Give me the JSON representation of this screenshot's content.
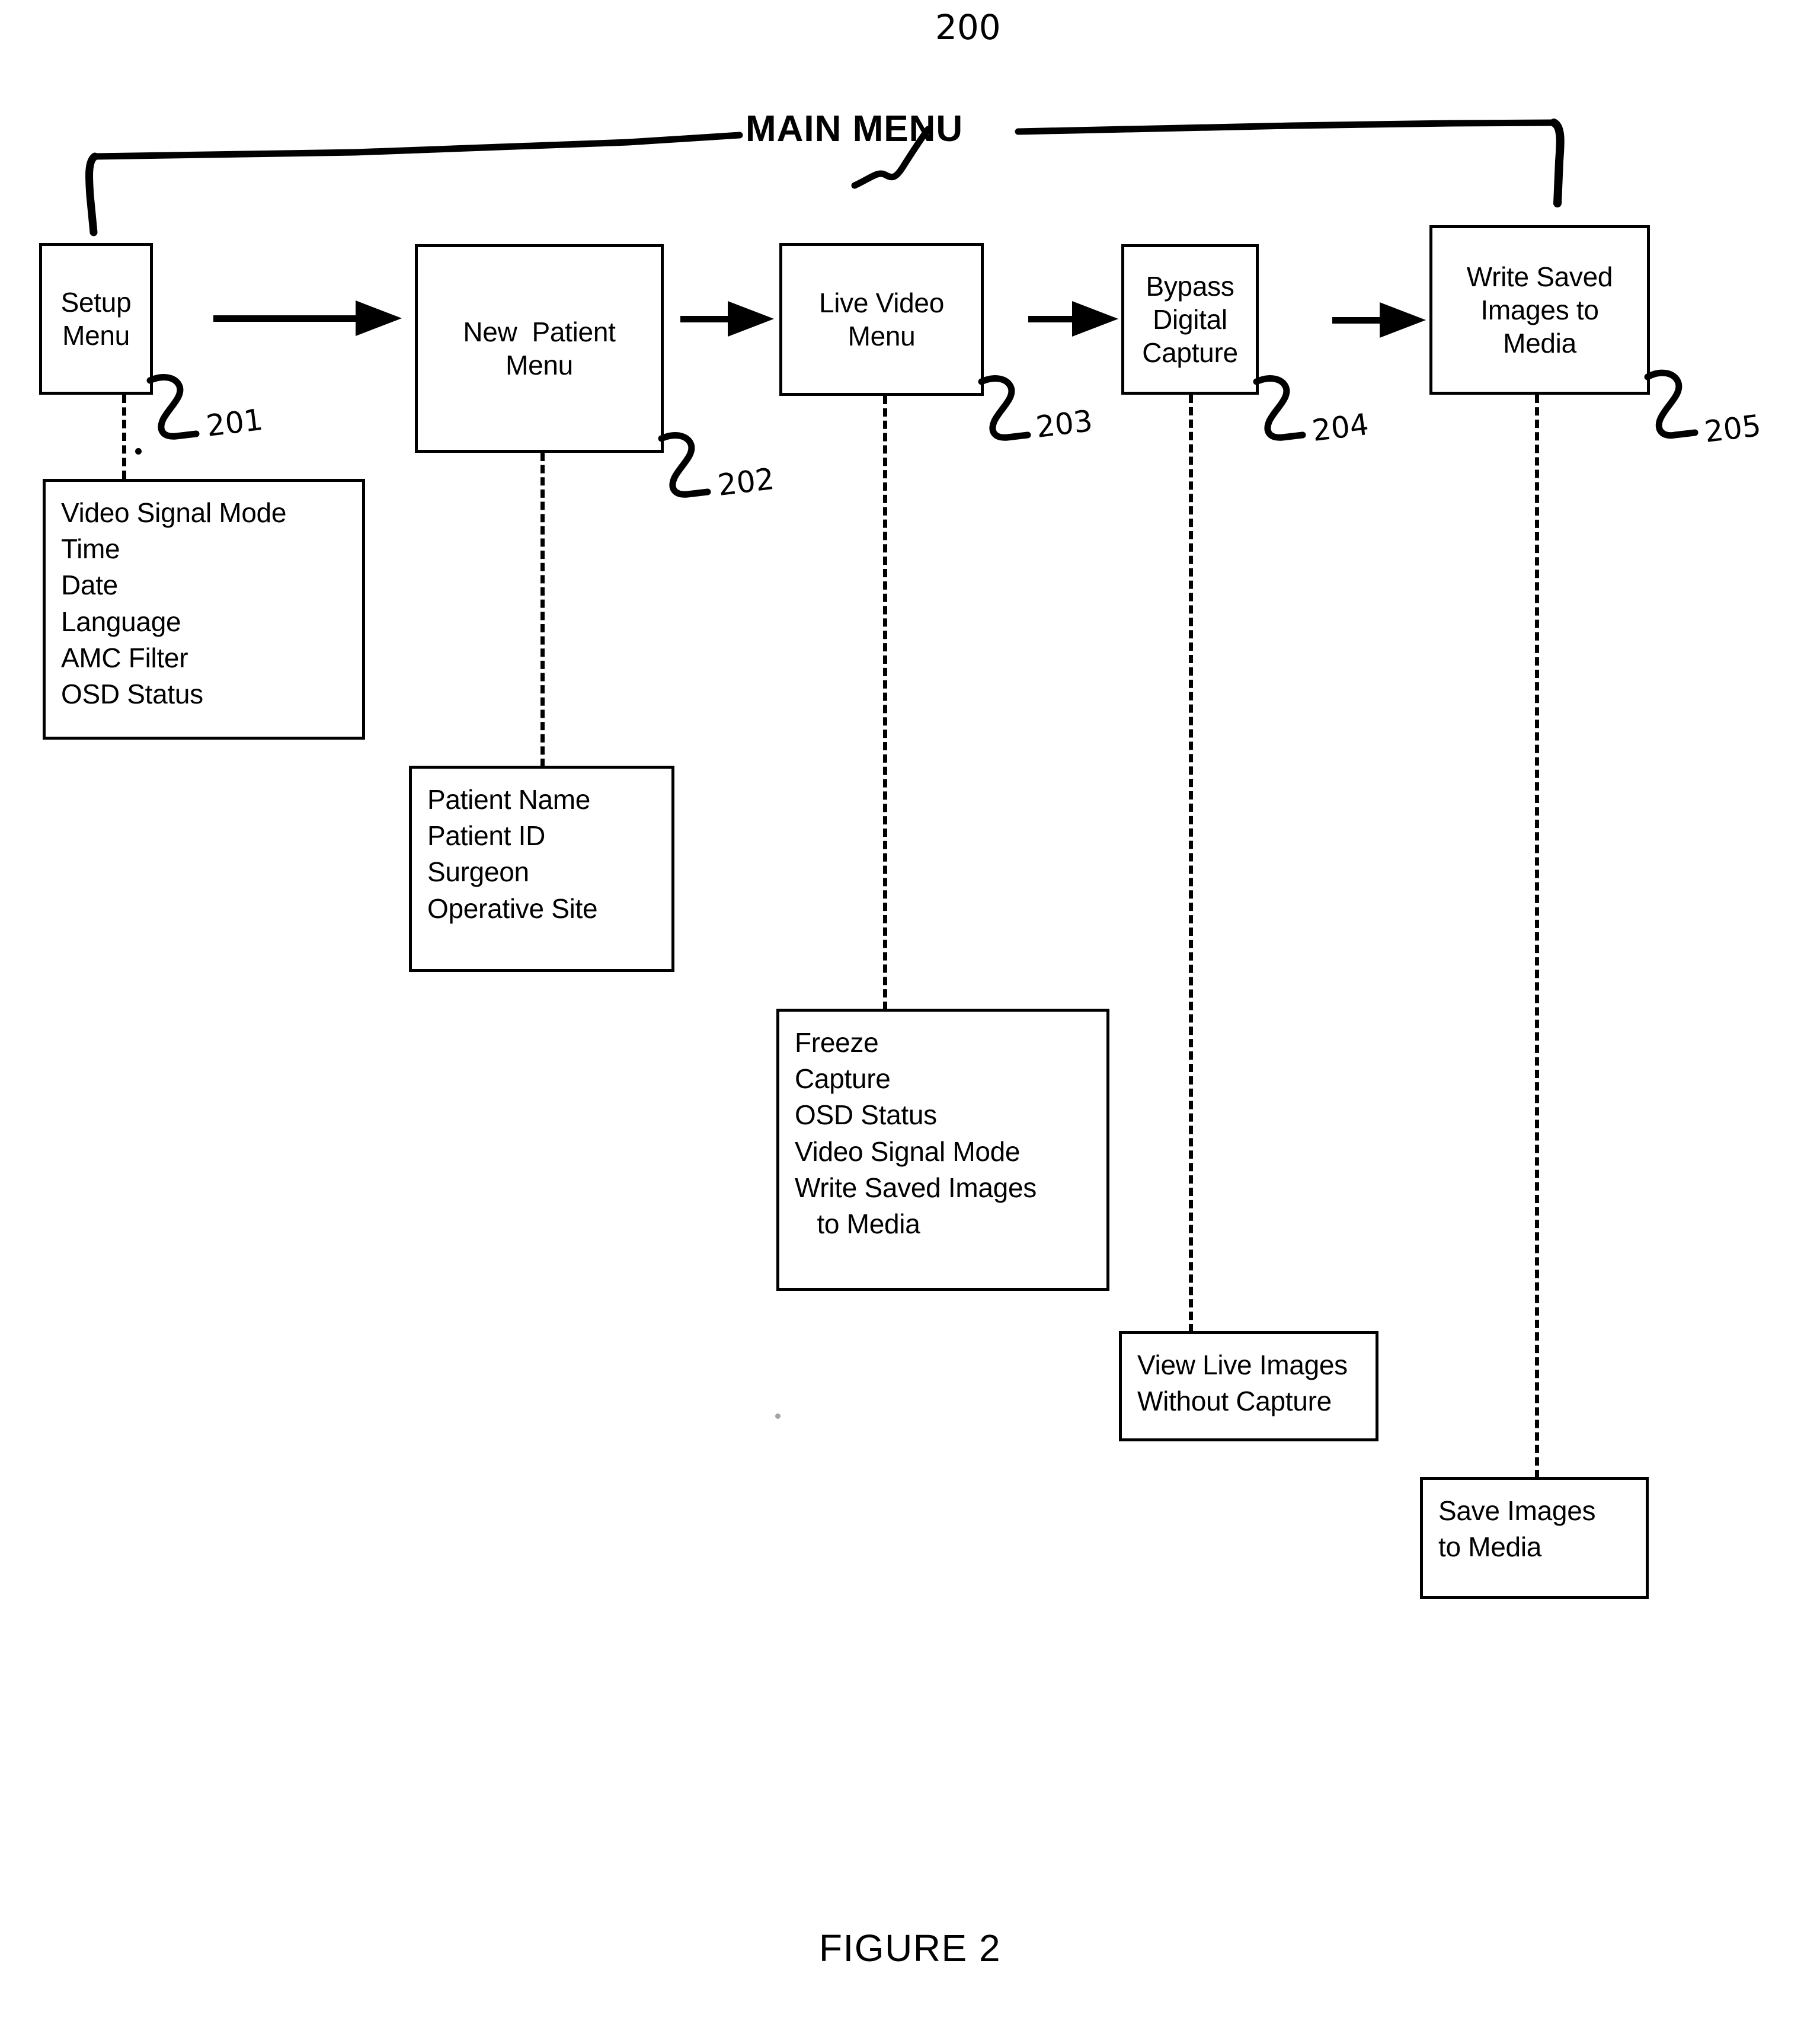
{
  "figure": {
    "caption": "FIGURE 2",
    "main_menu_label": "MAIN MENU",
    "main_menu_ref": "200"
  },
  "refs": {
    "setup_menu": "201",
    "new_patient_menu": "202",
    "live_video_menu": "203",
    "bypass_digital_capture": "204",
    "write_saved_images": "205"
  },
  "top_row": [
    {
      "id": "setup-menu",
      "lines": [
        "Setup",
        "Menu"
      ],
      "ref": "201"
    },
    {
      "id": "new-patient-menu",
      "lines": [
        "New  Patient",
        "Menu"
      ],
      "ref": "202"
    },
    {
      "id": "live-video-menu",
      "lines": [
        "Live Video",
        "Menu"
      ],
      "ref": "203"
    },
    {
      "id": "bypass-digital-capture",
      "lines": [
        "Bypass",
        "Digital",
        "Capture"
      ],
      "ref": "204"
    },
    {
      "id": "write-saved-images-to-media",
      "lines": [
        "Write Saved",
        "Images to",
        "Media"
      ],
      "ref": "205"
    }
  ],
  "detail_boxes": [
    {
      "id": "setup-menu-options",
      "parent": "setup-menu",
      "items": [
        "Video Signal Mode",
        "Time",
        "Date",
        "Language",
        "AMC Filter",
        "OSD Status"
      ]
    },
    {
      "id": "new-patient-menu-options",
      "parent": "new-patient-menu",
      "items": [
        "Patient Name",
        "Patient ID",
        "Surgeon",
        "Operative Site"
      ]
    },
    {
      "id": "live-video-menu-options",
      "parent": "live-video-menu",
      "items": [
        "Freeze",
        "Capture",
        "OSD Status",
        "Video Signal Mode",
        "Write Saved Images",
        "   to Media"
      ]
    },
    {
      "id": "bypass-digital-capture-options",
      "parent": "bypass-digital-capture",
      "items": [
        "View Live Images",
        "Without Capture"
      ]
    },
    {
      "id": "write-saved-images-options",
      "parent": "write-saved-images-to-media",
      "items": [
        "Save Images",
        "to Media"
      ]
    }
  ],
  "colors": {
    "ink": "#000000",
    "paper": "#ffffff"
  }
}
